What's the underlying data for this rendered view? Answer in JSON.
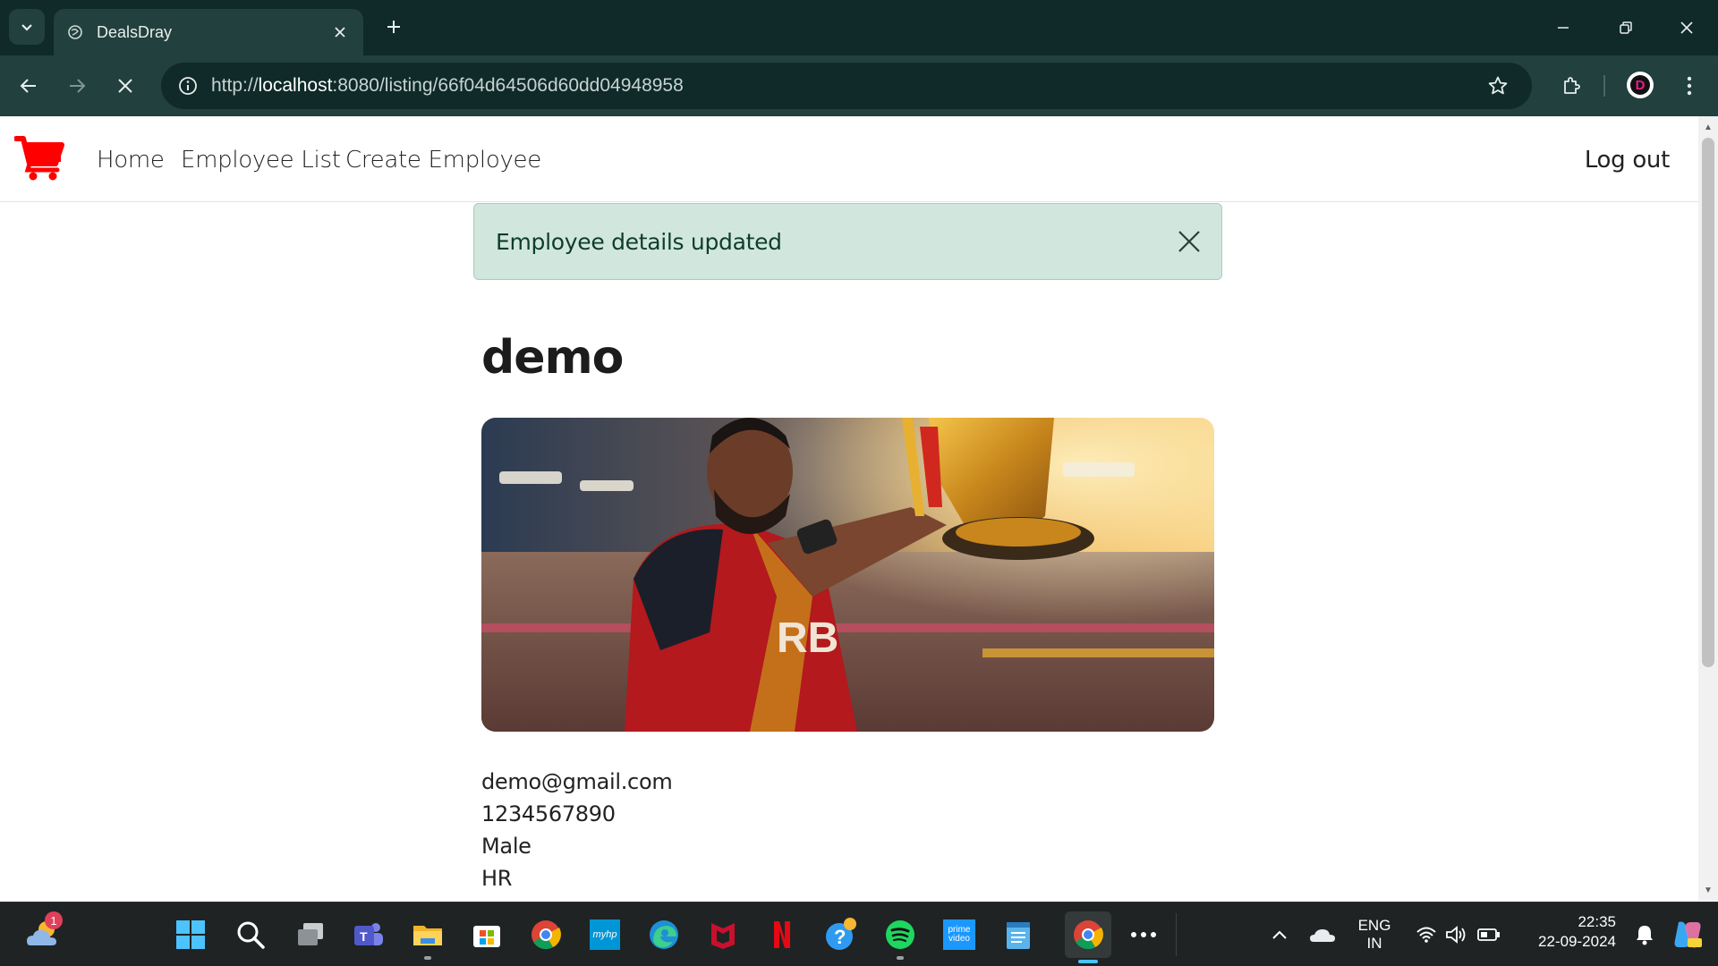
{
  "browser": {
    "tab_title": "DealsDray",
    "url_prefix": "http://",
    "url_host": "localhost",
    "url_rest": ":8080/listing/66f04d64506d60dd04948958",
    "tab_search_icon": "chevron-down-icon",
    "favicon": "globe-icon"
  },
  "navbar": {
    "logo_icon": "shopping-cart-icon",
    "logo_color": "#ff0000",
    "links": [
      {
        "label": "Home"
      },
      {
        "label": "Employee List"
      },
      {
        "label": "Create Employee"
      }
    ],
    "logout_label": "Log out"
  },
  "alert": {
    "message": "Employee details updated",
    "background": "#d1e7dd"
  },
  "employee": {
    "name": "demo",
    "photo_description": "",
    "email": "demo@gmail.com",
    "mobile": "1234567890",
    "gender": "Male",
    "designation": "HR",
    "jersey_text": "RB"
  },
  "taskbar": {
    "weather_badge": "1",
    "language_line1": "ENG",
    "language_line2": "IN",
    "time": "22:35",
    "date": "22-09-2024",
    "apps": [
      "windows-start-icon",
      "search-icon",
      "task-view-icon",
      "teams-icon",
      "file-explorer-icon",
      "store-icon",
      "chrome-icon",
      "myhp-icon",
      "edge-icon",
      "mcafee-icon",
      "netflix-icon",
      "help-icon",
      "spotify-icon",
      "prime-video-icon",
      "notepad-icon",
      "chrome-active-icon",
      "more-icon"
    ],
    "myhp_label": "myhp",
    "prime_label": "prime video"
  }
}
